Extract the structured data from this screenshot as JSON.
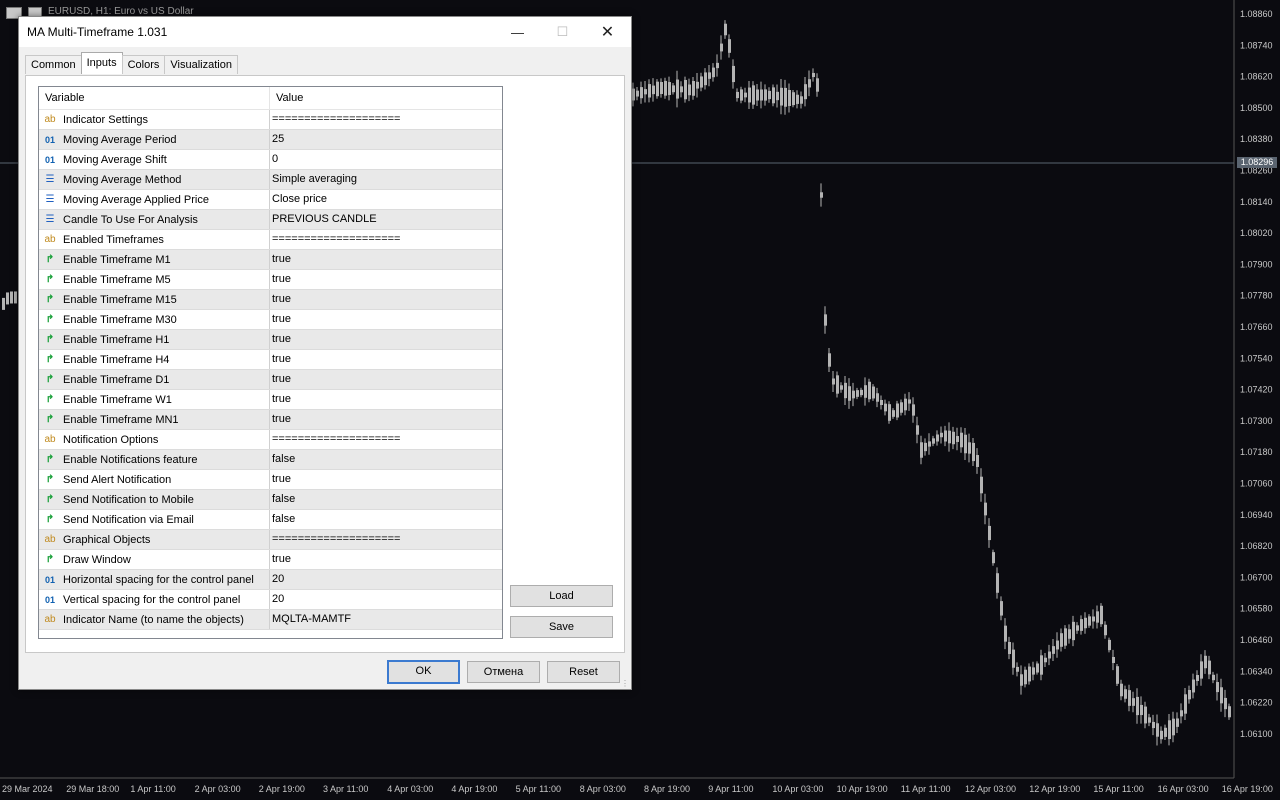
{
  "chart": {
    "title": "EURUSD, H1: Euro vs US Dollar",
    "price_labels": [
      "1.08860",
      "1.08740",
      "1.08620",
      "1.08500",
      "1.08380",
      "1.08260",
      "1.08140",
      "1.08020",
      "1.07900",
      "1.07780",
      "1.07660",
      "1.07540",
      "1.07420",
      "1.07300",
      "1.07180",
      "1.07060",
      "1.06940",
      "1.06820",
      "1.06700",
      "1.06580",
      "1.06460",
      "1.06340",
      "1.06220",
      "1.06100"
    ],
    "current_price": "1.08296",
    "time_labels": [
      "29 Mar 2024",
      "29 Mar 18:00",
      "1 Apr 11:00",
      "2 Apr 03:00",
      "2 Apr 19:00",
      "3 Apr 11:00",
      "4 Apr 03:00",
      "4 Apr 19:00",
      "5 Apr 11:00",
      "8 Apr 03:00",
      "8 Apr 19:00",
      "9 Apr 11:00",
      "10 Apr 03:00",
      "10 Apr 19:00",
      "11 Apr 11:00",
      "12 Apr 03:00",
      "12 Apr 19:00",
      "15 Apr 11:00",
      "16 Apr 03:00",
      "16 Apr 19:00"
    ],
    "colors": {
      "background": "#0b0b10",
      "candles": "#b4b4b4",
      "grid_line": "#5a6470"
    }
  },
  "dialog": {
    "title": "MA Multi-Timeframe 1.031",
    "tabs": [
      "Common",
      "Inputs",
      "Colors",
      "Visualization"
    ],
    "active_tab": "Inputs",
    "columns": {
      "variable": "Variable",
      "value": "Value"
    },
    "rows": [
      {
        "icon": "ab",
        "variable": "Indicator Settings",
        "value": "===================="
      },
      {
        "icon": "num",
        "variable": "Moving Average Period",
        "value": "25"
      },
      {
        "icon": "num",
        "variable": "Moving Average Shift",
        "value": "0"
      },
      {
        "icon": "enum",
        "variable": "Moving Average Method",
        "value": "Simple averaging"
      },
      {
        "icon": "enum",
        "variable": "Moving Average Applied Price",
        "value": "Close price"
      },
      {
        "icon": "enum",
        "variable": "Candle To Use For Analysis",
        "value": "PREVIOUS CANDLE"
      },
      {
        "icon": "ab",
        "variable": "Enabled Timeframes",
        "value": "===================="
      },
      {
        "icon": "bool",
        "variable": "Enable Timeframe M1",
        "value": "true"
      },
      {
        "icon": "bool",
        "variable": "Enable Timeframe M5",
        "value": "true"
      },
      {
        "icon": "bool",
        "variable": "Enable Timeframe M15",
        "value": "true"
      },
      {
        "icon": "bool",
        "variable": "Enable Timeframe M30",
        "value": "true"
      },
      {
        "icon": "bool",
        "variable": "Enable Timeframe H1",
        "value": "true"
      },
      {
        "icon": "bool",
        "variable": "Enable Timeframe H4",
        "value": "true"
      },
      {
        "icon": "bool",
        "variable": "Enable Timeframe D1",
        "value": "true"
      },
      {
        "icon": "bool",
        "variable": "Enable Timeframe W1",
        "value": "true"
      },
      {
        "icon": "bool",
        "variable": "Enable Timeframe MN1",
        "value": "true"
      },
      {
        "icon": "ab",
        "variable": "Notification Options",
        "value": "===================="
      },
      {
        "icon": "bool",
        "variable": "Enable Notifications feature",
        "value": "false"
      },
      {
        "icon": "bool",
        "variable": "Send Alert Notification",
        "value": "true"
      },
      {
        "icon": "bool",
        "variable": "Send Notification to Mobile",
        "value": "false"
      },
      {
        "icon": "bool",
        "variable": "Send Notification via Email",
        "value": "false"
      },
      {
        "icon": "ab",
        "variable": "Graphical Objects",
        "value": "===================="
      },
      {
        "icon": "bool",
        "variable": "Draw Window",
        "value": "true"
      },
      {
        "icon": "num",
        "variable": "Horizontal spacing for the control panel",
        "value": "20"
      },
      {
        "icon": "num",
        "variable": "Vertical spacing for the control panel",
        "value": "20"
      },
      {
        "icon": "ab",
        "variable": "Indicator Name (to name the objects)",
        "value": "MQLTA-MAMTF"
      }
    ],
    "buttons": {
      "load": "Load",
      "save": "Save",
      "ok": "OK",
      "cancel": "Отмена",
      "reset": "Reset"
    },
    "icon_glyphs": {
      "ab": "ab",
      "num": "01",
      "enum": "☰",
      "bool": "↱"
    }
  }
}
